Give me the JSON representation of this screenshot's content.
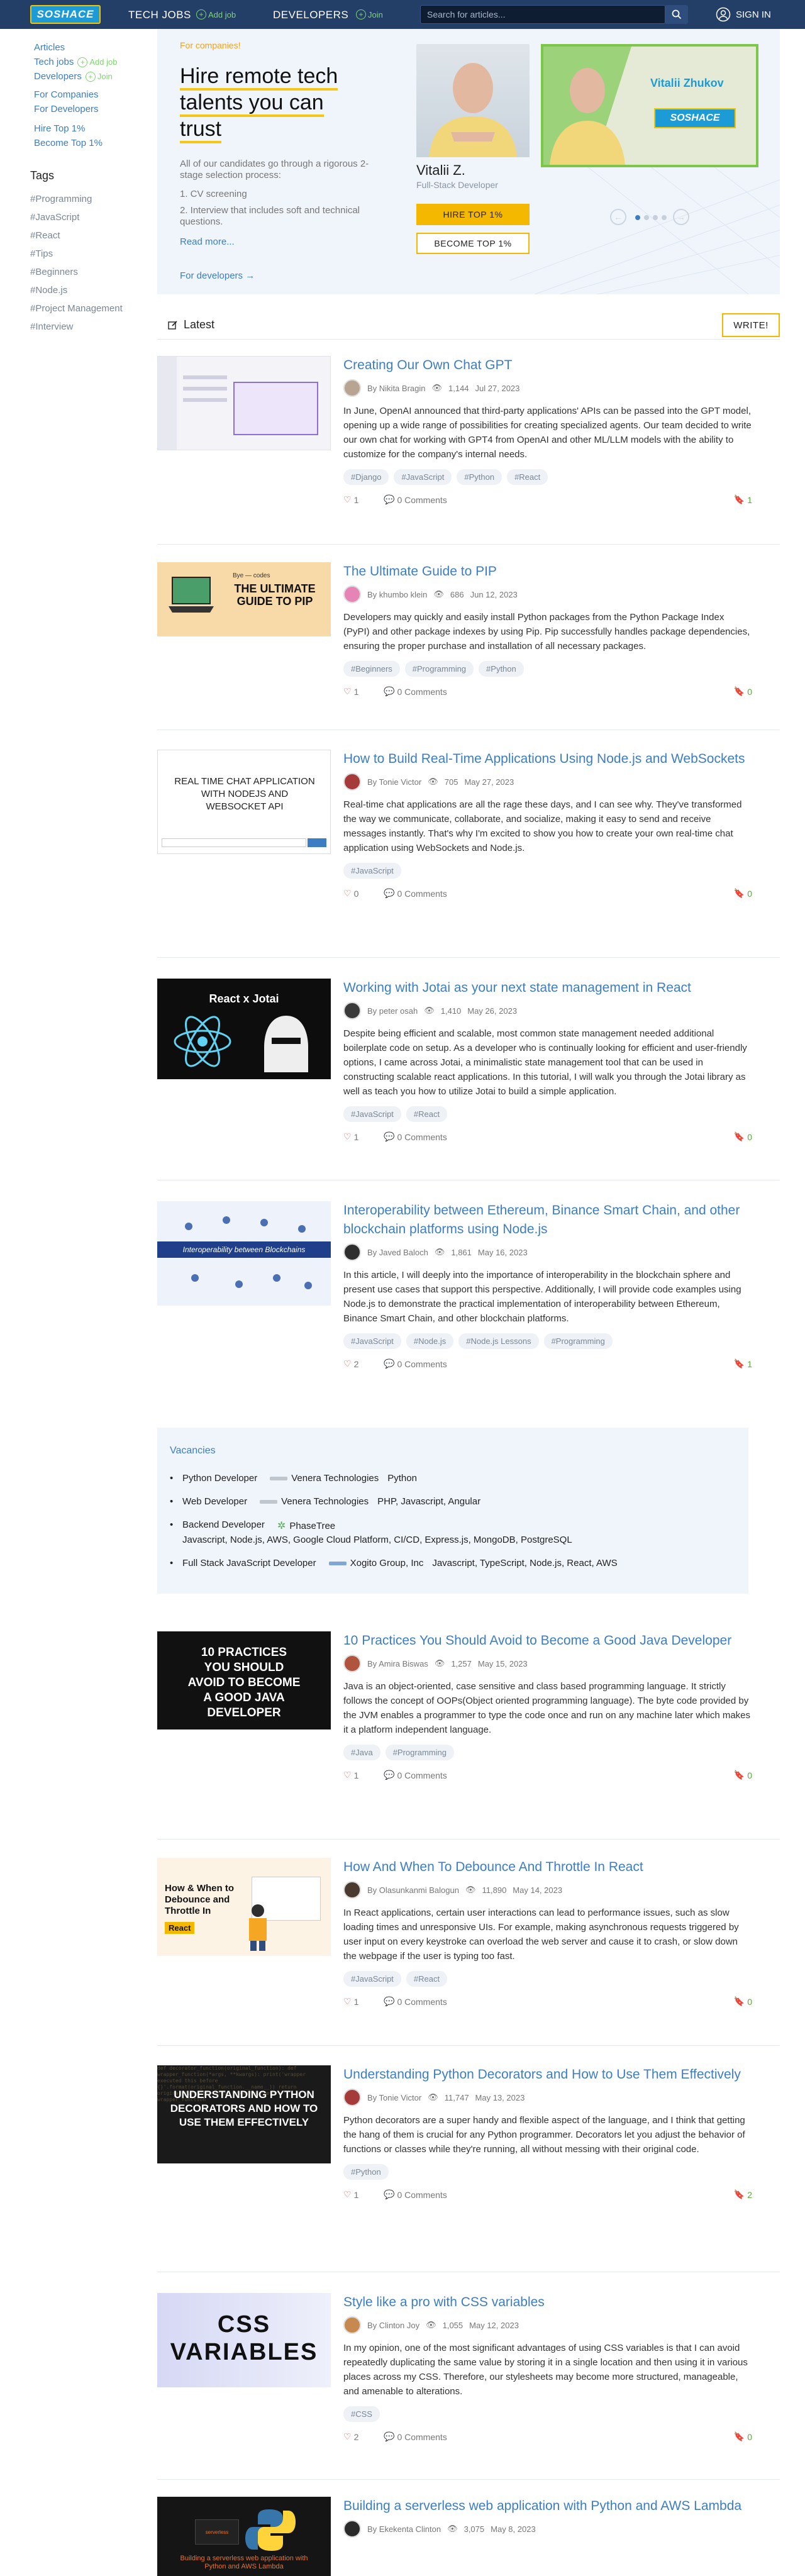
{
  "header": {
    "logo": "SOSHACE",
    "nav_tech": "TECH JOBS",
    "nav_tech_add": "Add job",
    "nav_dev": "DEVELOPERS",
    "nav_dev_add": "Join",
    "search_placeholder": "Search for articles...",
    "signin": "SIGN IN"
  },
  "sidebar": {
    "articles": "Articles",
    "tech_jobs": "Tech jobs",
    "add_job": "Add job",
    "developers": "Developers",
    "join": "Join",
    "for_companies": "For Companies",
    "for_developers": "For Developers",
    "hire_top": "Hire Top 1%",
    "become_top": "Become Top 1%",
    "tags_title": "Tags",
    "tags": [
      "#Programming",
      "#JavaScript",
      "#React",
      "#Tips",
      "#Beginners",
      "#Node.js",
      "#Project Management",
      "#Interview"
    ]
  },
  "hero": {
    "for_companies": "For companies!",
    "title": "Hire remote tech talents you can trust",
    "desc": "All of our candidates go through a rigorous 2-stage selection process:",
    "step1": "1. CV screening",
    "step2": "2. Interview that includes soft and technical questions.",
    "read_more": "Read more...",
    "for_devs": "For developers →",
    "name": "Vitalii Z.",
    "role": "Full-Stack Developer",
    "card_name": "Vitalii Zhukov",
    "card_logo": "SOSHACE",
    "hire_btn": "HIRE TOP 1%",
    "become_btn": "BECOME TOP 1%"
  },
  "latest": {
    "title": "Latest",
    "write": "WRITE!"
  },
  "posts": [
    {
      "title": "Creating Our Own Chat GPT",
      "author": "By Nikita Bragin",
      "views": "1,144",
      "date": "Jul 27, 2023",
      "text": "In June, OpenAI announced that third-party applications' APIs can be passed into the GPT model, opening up a wide range of possibilities for creating specialized agents. Our team decided to write our own chat for working with GPT4 from OpenAI and other ML/LLM models with the ability to customize for the company's internal needs.",
      "tags": [
        "#Django",
        "#JavaScript",
        "#Python",
        "#React"
      ],
      "likes": "1",
      "comments": "0 Comments",
      "bookmarks": "1"
    },
    {
      "title": "The Ultimate Guide to PIP",
      "author": "By khumbo klein",
      "views": "686",
      "date": "Jun 12, 2023",
      "text": "Developers may quickly and easily install Python packages from the Python Package Index (PyPI) and other package indexes by using Pip. Pip successfully handles package dependencies, ensuring the proper purchase and installation of all necessary packages.",
      "tags": [
        "#Beginners",
        "#Programming",
        "#Python"
      ],
      "likes": "1",
      "comments": "0 Comments",
      "bookmarks": "0",
      "thumb_top": "Bye — codes",
      "thumb_title": "THE ULTIMATE GUIDE TO PIP"
    },
    {
      "title": "How to Build Real-Time Applications Using Node.js and WebSockets",
      "author": "By Tonie Victor",
      "views": "705",
      "date": "May 27, 2023",
      "text": "Real-time chat applications are all the rage these days, and I can see why. They've transformed the way we communicate, collaborate, and socialize, making it easy to send and receive messages instantly. That's why I'm excited to show you how to create your own real-time chat application using WebSockets and Node.js.",
      "tags": [
        "#JavaScript"
      ],
      "likes": "0",
      "comments": "0 Comments",
      "bookmarks": "0",
      "thumb_title": "REAL TIME CHAT APPLICATION WITH NODEJS AND WEBSOCKET API"
    },
    {
      "title": "Working with Jotai as your next state management in React",
      "author": "By peter osah",
      "views": "1,410",
      "date": "May 26, 2023",
      "text": "Despite being efficient and scalable, most common state management needed additional boilerplate code on setup. As a developer who is continually looking for efficient and user-friendly options, I came across Jotai, a minimalistic state management tool that can be used in constructing scalable react applications. In this tutorial, I will walk you through the Jotai library as well as teach you how to utilize Jotai to build a simple application.",
      "tags": [
        "#JavaScript",
        "#React"
      ],
      "likes": "1",
      "comments": "0 Comments",
      "bookmarks": "0",
      "thumb_title": "React x Jotai"
    },
    {
      "title": "Interoperability between Ethereum, Binance Smart Chain, and other blockchain platforms using Node.js",
      "author": "By Javed Baloch",
      "views": "1,861",
      "date": "May 16, 2023",
      "text": "In this article, I will deeply into the importance of interoperability in the blockchain sphere and present use cases that support this perspective. Additionally, I will provide code examples using Node.js to demonstrate the practical implementation of interoperability between Ethereum, Binance Smart Chain, and other blockchain platforms.",
      "tags": [
        "#JavaScript",
        "#Node.js",
        "#Node.js Lessons",
        "#Programming"
      ],
      "likes": "2",
      "comments": "0 Comments",
      "bookmarks": "1",
      "thumb_title": "Interoperability between Blockchains"
    },
    {
      "title": "10 Practices You Should Avoid to Become a Good Java Developer",
      "author": "By Amira Biswas",
      "views": "1,257",
      "date": "May 15, 2023",
      "text": "Java is an object-oriented, case sensitive and class based programming language. It strictly follows the concept of OOPs(Object oriented programming language). The byte code provided by the JVM enables a programmer to type the code once and run on any machine later which makes it a platform independent language.",
      "tags": [
        "#Java",
        "#Programming"
      ],
      "likes": "1",
      "comments": "0 Comments",
      "bookmarks": "0",
      "thumb_title": "10 PRACTICES YOU SHOULD AVOID TO BECOME A GOOD JAVA DEVELOPER"
    },
    {
      "title": "How And When To Debounce And Throttle In React",
      "author": "By Olasunkanmi Balogun",
      "views": "11,890",
      "date": "May 14, 2023",
      "text": "In React applications, certain user interactions can lead to performance issues, such as slow loading times and unresponsive UIs. For example, making asynchronous requests triggered by user input on every keystroke can overload the web server and cause it to crash, or slow down the webpage if the user is typing too fast.",
      "tags": [
        "#JavaScript",
        "#React"
      ],
      "likes": "1",
      "comments": "0 Comments",
      "bookmarks": "0",
      "thumb_title": "How & When to Debounce and Throttle In",
      "thumb_tag": "React"
    },
    {
      "title": "Understanding Python Decorators and How to Use Them Effectively",
      "author": "By Tonie Victor",
      "views": "11,747",
      "date": "May 13, 2023",
      "text": "Python decorators are a super handy and flexible aspect of the language, and I think that getting the hang of them is crucial for any Python programmer. Decorators let you adjust the behavior of functions or classes while they're running, all without messing with their original code.",
      "tags": [
        "#Python"
      ],
      "likes": "1",
      "comments": "0 Comments",
      "bookmarks": "2",
      "thumb_title": "UNDERSTANDING PYTHON DECORATORS AND HOW TO USE THEM EFFECTIVELY"
    },
    {
      "title": "Style like a pro with CSS variables",
      "author": "By Clinton Joy",
      "views": "1,055",
      "date": "May 12, 2023",
      "text": "In my opinion, one of the most significant advantages of using CSS variables is that I can avoid repeatedly duplicating the same value by storing it in a single location and then using it in various places across my CSS. Therefore, our stylesheets may become more structured, manageable, and amenable to alterations.",
      "tags": [
        "#CSS"
      ],
      "likes": "2",
      "comments": "0 Comments",
      "bookmarks": "0",
      "thumb_title": "CSS VARIABLES"
    },
    {
      "title": "Building a serverless web application with Python and AWS Lambda",
      "author": "By Ekekenta Clinton",
      "views": "3,075",
      "date": "May 8, 2023",
      "thumb_title": "Building a serverless web application with Python and AWS Lambda",
      "thumb_tag": "serverless"
    }
  ],
  "vacancies": {
    "title": "Vacancies",
    "rows": [
      {
        "role": "Python Developer",
        "company": "Venera Technologies",
        "skills": "Python"
      },
      {
        "role": "Web Developer",
        "company": "Venera Technologies",
        "skills": "PHP, Javascript, Angular"
      },
      {
        "role": "Backend Developer",
        "company": "PhaseTree",
        "skills": "Javascript, Node.js, AWS, Google Cloud Platform, CI/CD, Express.js, MongoDB, PostgreSQL"
      },
      {
        "role": "Full Stack JavaScript Developer",
        "company": "Xogito Group, Inc",
        "skills": "Javascript, TypeScript, Node.js, React, AWS"
      }
    ]
  },
  "colors": {
    "header": "#233e67",
    "link": "#3d7dc4",
    "accent": "#f5b800",
    "green": "#7ed56f"
  }
}
